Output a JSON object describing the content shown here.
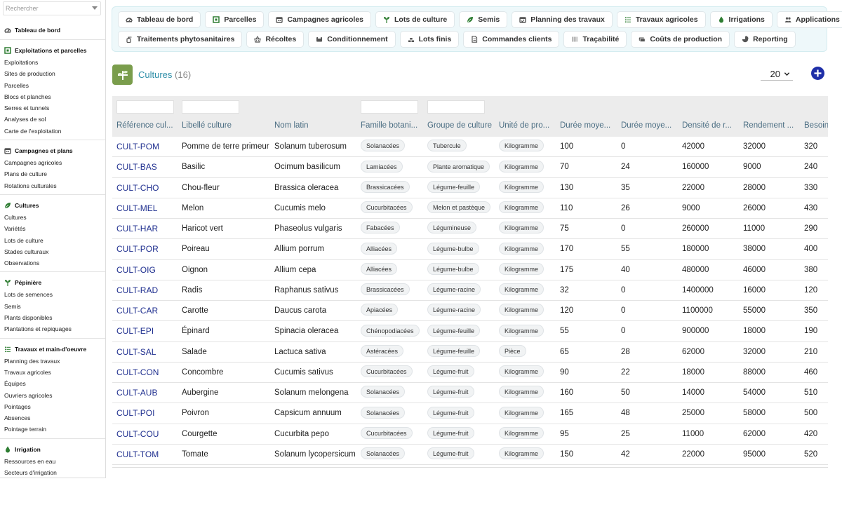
{
  "sidebar": {
    "search_placeholder": "Rechercher",
    "sections": [
      {
        "title": "Tableau de bord",
        "icon": "dashboard-icon",
        "items": []
      },
      {
        "title": "Exploitations et parcelles",
        "icon": "map-icon",
        "items": [
          "Exploitations",
          "Sites de production",
          "Parcelles",
          "Blocs et planches",
          "Serres et tunnels",
          "Analyses de sol",
          "Carte de l'exploitation"
        ]
      },
      {
        "title": "Campagnes et plans",
        "icon": "calendar-icon",
        "items": [
          "Campagnes agricoles",
          "Plans de culture",
          "Rotations culturales"
        ]
      },
      {
        "title": "Cultures",
        "icon": "leaf-icon",
        "items": [
          "Cultures",
          "Variétés",
          "Lots de culture",
          "Stades culturaux",
          "Observations"
        ]
      },
      {
        "title": "Pépinière",
        "icon": "sprout-icon",
        "items": [
          "Lots de semences",
          "Semis",
          "Plants disponibles",
          "Plantations et repiquages"
        ]
      },
      {
        "title": "Travaux et main-d'oeuvre",
        "icon": "list-icon",
        "items": [
          "Planning des travaux",
          "Travaux agricoles",
          "Équipes",
          "Ouvriers agricoles",
          "Pointages",
          "Absences",
          "Pointage terrain"
        ]
      },
      {
        "title": "Irrigation",
        "icon": "drop-icon",
        "items": [
          "Ressources en eau",
          "Secteurs d'irrigation"
        ]
      }
    ]
  },
  "topnav": {
    "row1": [
      {
        "label": "Tableau de bord",
        "icon": "dashboard-icon"
      },
      {
        "label": "Parcelles",
        "icon": "map-icon"
      },
      {
        "label": "Campagnes agricoles",
        "icon": "calendar-icon"
      },
      {
        "label": "Lots de culture",
        "icon": "sprout-icon"
      },
      {
        "label": "Semis",
        "icon": "leaf-icon"
      },
      {
        "label": "Planning des travaux",
        "icon": "calendar-check-icon"
      },
      {
        "label": "Travaux agricoles",
        "icon": "list-icon"
      },
      {
        "label": "Irrigations",
        "icon": "drop-icon"
      },
      {
        "label": "Applications d'engrais",
        "icon": "people-icon"
      }
    ],
    "row2": [
      {
        "label": "Traitements phytosanitaires",
        "icon": "spray-icon"
      },
      {
        "label": "Récoltes",
        "icon": "basket-icon"
      },
      {
        "label": "Conditionnement",
        "icon": "box-icon"
      },
      {
        "label": "Lots finis",
        "icon": "stack-icon"
      },
      {
        "label": "Commandes clients",
        "icon": "document-icon"
      },
      {
        "label": "Traçabilité",
        "icon": "barcode-icon"
      },
      {
        "label": "Coûts de production",
        "icon": "money-icon"
      },
      {
        "label": "Reporting",
        "icon": "chart-icon"
      }
    ]
  },
  "page": {
    "title": "Cultures",
    "count": "(16)",
    "page_size": "20"
  },
  "table": {
    "columns": [
      "Référence cul...",
      "Libellé culture",
      "Nom latin",
      "Famille botani...",
      "Groupe de culture",
      "Unité de pro...",
      "Durée moye...",
      "Durée moye...",
      "Densité de r...",
      "Rendement ...",
      "Besoin"
    ],
    "rows": [
      [
        "CULT-POM",
        "Pomme de terre primeur",
        "Solanum tuberosum",
        "Solanacées",
        "Tubercule",
        "Kilogramme",
        "100",
        "0",
        "42000",
        "32000",
        "320"
      ],
      [
        "CULT-BAS",
        "Basilic",
        "Ocimum basilicum",
        "Lamiacées",
        "Plante aromatique",
        "Kilogramme",
        "70",
        "24",
        "160000",
        "9000",
        "240"
      ],
      [
        "CULT-CHO",
        "Chou-fleur",
        "Brassica oleracea",
        "Brassicacées",
        "Légume-feuille",
        "Kilogramme",
        "130",
        "35",
        "22000",
        "28000",
        "330"
      ],
      [
        "CULT-MEL",
        "Melon",
        "Cucumis melo",
        "Cucurbitacées",
        "Melon et pastèque",
        "Kilogramme",
        "110",
        "26",
        "9000",
        "26000",
        "430"
      ],
      [
        "CULT-HAR",
        "Haricot vert",
        "Phaseolus vulgaris",
        "Fabacées",
        "Légumineuse",
        "Kilogramme",
        "75",
        "0",
        "260000",
        "11000",
        "290"
      ],
      [
        "CULT-POR",
        "Poireau",
        "Allium porrum",
        "Alliacées",
        "Légume-bulbe",
        "Kilogramme",
        "170",
        "55",
        "180000",
        "38000",
        "400"
      ],
      [
        "CULT-OIG",
        "Oignon",
        "Allium cepa",
        "Alliacées",
        "Légume-bulbe",
        "Kilogramme",
        "175",
        "40",
        "480000",
        "46000",
        "380"
      ],
      [
        "CULT-RAD",
        "Radis",
        "Raphanus sativus",
        "Brassicacées",
        "Légume-racine",
        "Kilogramme",
        "32",
        "0",
        "1400000",
        "16000",
        "120"
      ],
      [
        "CULT-CAR",
        "Carotte",
        "Daucus carota",
        "Apiacées",
        "Légume-racine",
        "Kilogramme",
        "120",
        "0",
        "1100000",
        "55000",
        "350"
      ],
      [
        "CULT-EPI",
        "Épinard",
        "Spinacia oleracea",
        "Chénopodiacées",
        "Légume-feuille",
        "Kilogramme",
        "55",
        "0",
        "900000",
        "18000",
        "190"
      ],
      [
        "CULT-SAL",
        "Salade",
        "Lactuca sativa",
        "Astéracées",
        "Légume-feuille",
        "Pièce",
        "65",
        "28",
        "62000",
        "32000",
        "210"
      ],
      [
        "CULT-CON",
        "Concombre",
        "Cucumis sativus",
        "Cucurbitacées",
        "Légume-fruit",
        "Kilogramme",
        "90",
        "22",
        "18000",
        "88000",
        "460"
      ],
      [
        "CULT-AUB",
        "Aubergine",
        "Solanum melongena",
        "Solanacées",
        "Légume-fruit",
        "Kilogramme",
        "160",
        "50",
        "14000",
        "54000",
        "510"
      ],
      [
        "CULT-POI",
        "Poivron",
        "Capsicum annuum",
        "Solanacées",
        "Légume-fruit",
        "Kilogramme",
        "165",
        "48",
        "25000",
        "58000",
        "500"
      ],
      [
        "CULT-COU",
        "Courgette",
        "Cucurbita pepo",
        "Cucurbitacées",
        "Légume-fruit",
        "Kilogramme",
        "95",
        "25",
        "11000",
        "62000",
        "420"
      ],
      [
        "CULT-TOM",
        "Tomate",
        "Solanum lycopersicum",
        "Solanacées",
        "Légume-fruit",
        "Kilogramme",
        "150",
        "42",
        "22000",
        "95000",
        "520"
      ]
    ]
  },
  "colors": {
    "accent_title": "#2f8fa8",
    "nav_background": "#eef8fa",
    "add_button": "#1f2fa8",
    "reference_link": "#1f2f8f",
    "icon_green": "#2e7d32",
    "app_icon_bg": "#7a9d4c"
  }
}
